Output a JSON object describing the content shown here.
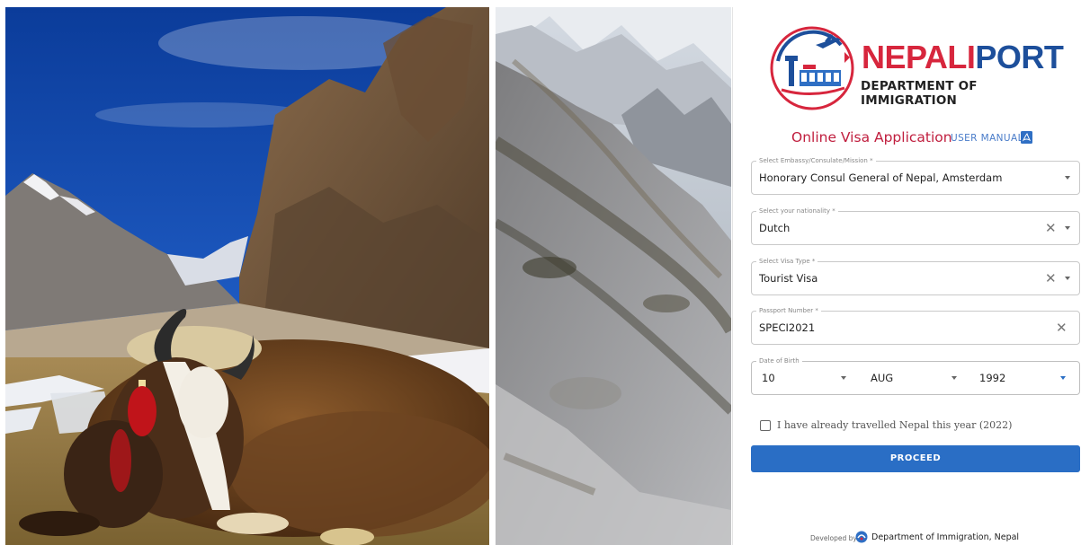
{
  "photos": {
    "left": "yak",
    "right": "mountain-slope"
  },
  "logo": {
    "title_red": "NEPALI",
    "title_blue": "PORT",
    "subtitle": "DEPARTMENT OF IMMIGRATION"
  },
  "form": {
    "heading": "Online Visa Application",
    "manual_link": "USER MANUAL",
    "embassy": {
      "label": "Select Embassy/Consulate/Mission *",
      "value": "Honorary Consul General of Nepal, Amsterdam"
    },
    "nationality": {
      "label": "Select your nationality *",
      "value": "Dutch"
    },
    "visa_type": {
      "label": "Select Visa Type *",
      "value": "Tourist Visa"
    },
    "passport": {
      "label": "Passport Number *",
      "value": "SPECI2021"
    },
    "dob": {
      "label": "Date of Birth",
      "day": "10",
      "month": "AUG",
      "year": "1992"
    },
    "travelled_checkbox": {
      "label": "I have already travelled Nepal this year (2022)",
      "checked": false
    },
    "proceed_label": "PROCEED"
  },
  "footer": {
    "prefix": "Developed by",
    "org": "Department of Immigration, Nepal"
  },
  "colors": {
    "brand_red": "#d7263d",
    "brand_blue": "#1d4f9b",
    "button_blue": "#2a6ec5"
  }
}
